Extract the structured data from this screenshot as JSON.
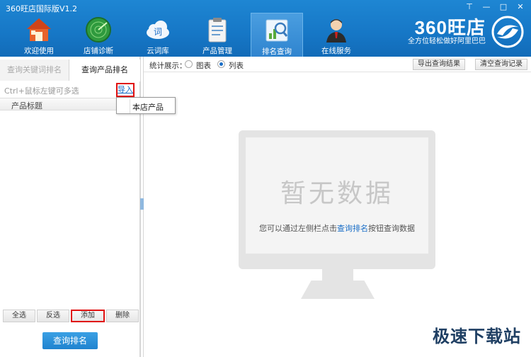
{
  "window": {
    "title": "360旺店国际版V1.2",
    "controls": [
      "⊤",
      "—",
      "□",
      "✕"
    ]
  },
  "nav": [
    {
      "label": "欢迎使用",
      "icon": "home-icon"
    },
    {
      "label": "店铺诊断",
      "icon": "radar-icon"
    },
    {
      "label": "云词库",
      "icon": "cloud-icon",
      "icon_text": "词"
    },
    {
      "label": "产品管理",
      "icon": "clipboard-icon"
    },
    {
      "label": "排名查询",
      "icon": "magnifier-chart-icon",
      "active": true
    },
    {
      "label": "在线服务",
      "icon": "support-agent-icon"
    }
  ],
  "logo": {
    "main": "360旺店",
    "sub": "全方位轻松做好阿里巴巴"
  },
  "left": {
    "tabs": [
      "查询关键词排名",
      "查询产品排名"
    ],
    "active_tab": 1,
    "hint": "Ctrl+鼠标左键可多选",
    "import_link": "导入",
    "column_header": "产品标题",
    "popup_item": "本店产品",
    "buttons": [
      "全选",
      "反选",
      "添加",
      "删除"
    ],
    "query_button": "查询排名"
  },
  "right": {
    "stat_label": "统计展示：",
    "radio_options": [
      "图表",
      "列表"
    ],
    "selected_option": "列表",
    "export_button": "导出查询结果",
    "clear_button": "清空查询记录",
    "empty_title": "暂无数据",
    "empty_desc_prefix": "您可以通过左侧栏点击",
    "empty_desc_link": "查询排名",
    "empty_desc_suffix": "按钮查询数据"
  },
  "watermark": "极速下载站",
  "colors": {
    "header": "#1677c6",
    "highlight_border": "#e01010",
    "link": "#1a6ec7"
  }
}
